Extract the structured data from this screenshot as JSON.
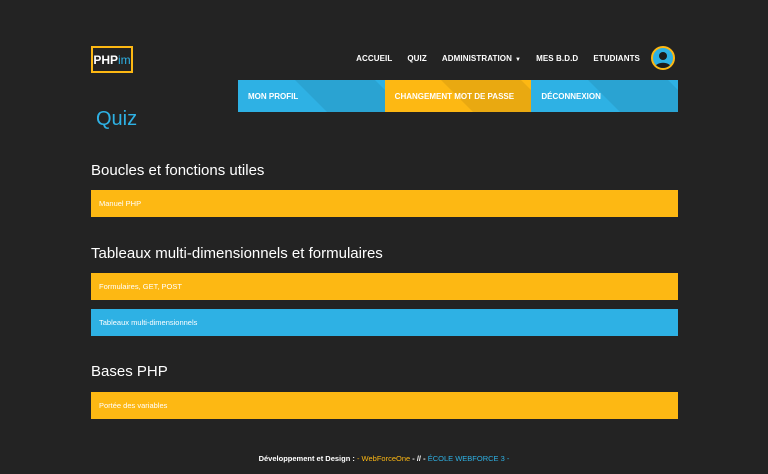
{
  "brand": {
    "logo_main": "PHP",
    "logo_accent": "im"
  },
  "nav": {
    "items": [
      "ACCUEIL",
      "QUIZ",
      "ADMINISTRATION",
      "MES B.D.D",
      "ETUDIANTS"
    ]
  },
  "subnav": {
    "items": [
      "MON PROFIL",
      "CHANGEMENT MOT DE PASSE",
      "DÉCONNEXION"
    ]
  },
  "colors": {
    "yellow": "#fdb813",
    "blue": "#2eb1e4",
    "background": "#232323"
  },
  "page": {
    "title": "Quiz"
  },
  "sections": [
    {
      "title": "Boucles et fonctions utiles",
      "items": [
        "Manuel PHP"
      ]
    },
    {
      "title": "Tableaux multi-dimensionnels et formulaires",
      "items": [
        "Formulaires, GET, POST",
        "Tableaux multi-dimensionnels"
      ]
    },
    {
      "title": "Bases PHP",
      "items": [
        "Portée des variables"
      ]
    }
  ],
  "footer": {
    "text": "Développement et Design :",
    "sep1": " - ",
    "link1": "WebForceOne",
    "sep2": " - // - ",
    "link2": "ÉCOLE WEBFORCE 3",
    "sep3": " -"
  }
}
